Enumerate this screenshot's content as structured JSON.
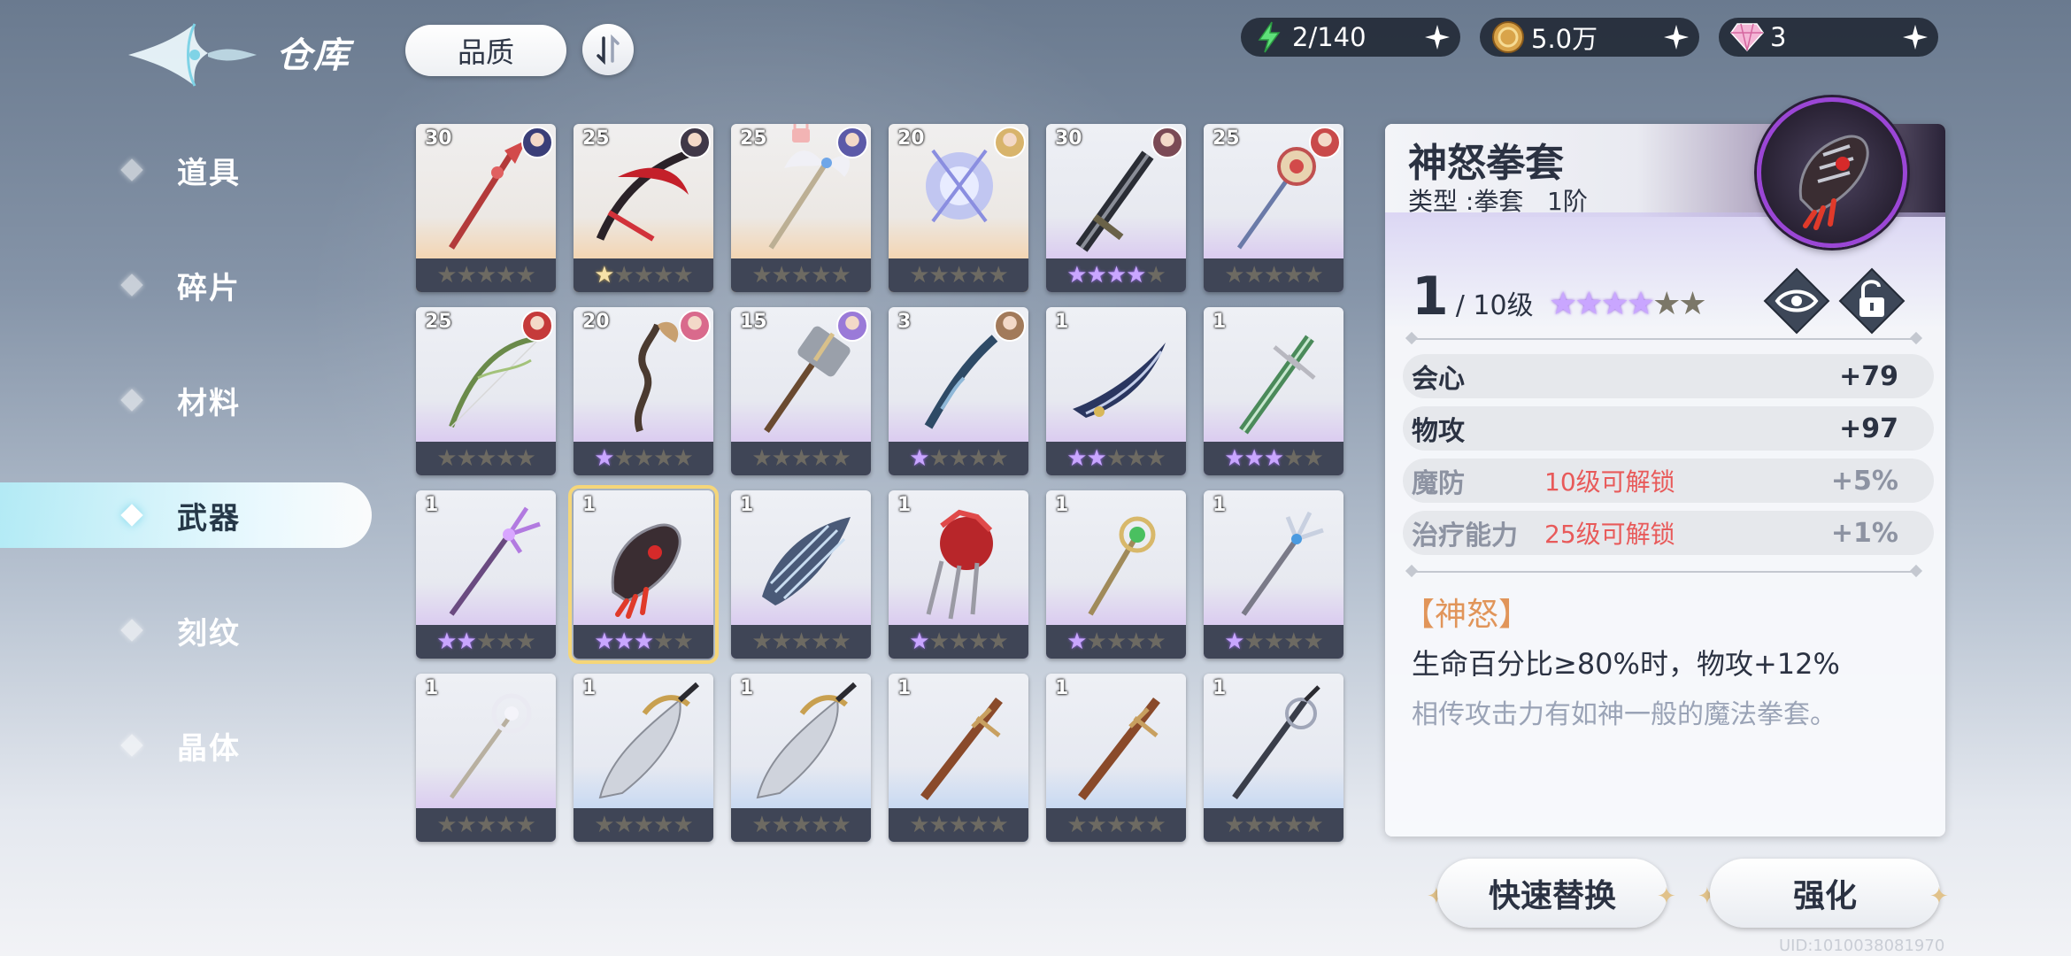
{
  "header": {
    "title": "仓库",
    "quality_label": "品质",
    "resources": [
      {
        "icon": "energy-icon",
        "value": "2/140"
      },
      {
        "icon": "coin-icon",
        "value": "5.0万"
      },
      {
        "icon": "diamond-icon",
        "value": "3"
      }
    ]
  },
  "sidebar": {
    "items": [
      {
        "label": "道具",
        "active": false
      },
      {
        "label": "碎片",
        "active": false
      },
      {
        "label": "材料",
        "active": false
      },
      {
        "label": "武器",
        "active": true
      },
      {
        "label": "刻纹",
        "active": false
      },
      {
        "label": "晶体",
        "active": false
      }
    ]
  },
  "inventory": {
    "items": [
      {
        "level": "30",
        "stars": 0,
        "rarity": "orange",
        "weapon": "red-lance",
        "avatar": "#3a3e78"
      },
      {
        "level": "25",
        "stars": 1,
        "star_color": "gold",
        "rarity": "orange",
        "weapon": "crimson-scythe",
        "avatar": "#403848"
      },
      {
        "level": "25",
        "stars": 0,
        "rarity": "orange",
        "weapon": "winged-staff",
        "avatar": "#5c5aa8",
        "locked": true
      },
      {
        "level": "20",
        "stars": 0,
        "rarity": "orange",
        "weapon": "crystal-orb",
        "avatar": "#d8b46c"
      },
      {
        "level": "30",
        "stars": 4,
        "rarity": "purple",
        "weapon": "dark-greatsword",
        "avatar": "#7b4a55"
      },
      {
        "level": "25",
        "stars": 0,
        "rarity": "purple",
        "weapon": "sun-scepter",
        "avatar": "#c94a4a"
      },
      {
        "level": "25",
        "stars": 0,
        "rarity": "purple",
        "weapon": "vine-bow",
        "avatar": "#c53a3a"
      },
      {
        "level": "20",
        "stars": 1,
        "rarity": "purple",
        "weapon": "serpent-staff",
        "avatar": "#d96a8c"
      },
      {
        "level": "15",
        "stars": 0,
        "rarity": "purple",
        "weapon": "battle-hammer",
        "avatar": "#9a7ad8"
      },
      {
        "level": "3",
        "stars": 1,
        "rarity": "purple",
        "weapon": "azure-rifle",
        "avatar": "#a27a5a"
      },
      {
        "level": "1",
        "stars": 2,
        "rarity": "purple",
        "weapon": "shadow-blade",
        "avatar": ""
      },
      {
        "level": "1",
        "stars": 3,
        "rarity": "purple",
        "weapon": "jade-sword",
        "avatar": ""
      },
      {
        "level": "1",
        "stars": 2,
        "rarity": "purple",
        "weapon": "violet-trident",
        "avatar": ""
      },
      {
        "level": "1",
        "stars": 3,
        "rarity": "purple",
        "weapon": "rage-gauntlet",
        "avatar": "",
        "selected": true
      },
      {
        "level": "1",
        "stars": 0,
        "rarity": "purple",
        "weapon": "frost-claw",
        "avatar": ""
      },
      {
        "level": "1",
        "stars": 1,
        "rarity": "purple",
        "weapon": "crimson-gauntlet",
        "avatar": ""
      },
      {
        "level": "1",
        "stars": 1,
        "rarity": "purple",
        "weapon": "emerald-staff",
        "avatar": ""
      },
      {
        "level": "1",
        "stars": 1,
        "rarity": "purple",
        "weapon": "silver-trident",
        "avatar": ""
      },
      {
        "level": "1",
        "stars": 0,
        "rarity": "purple",
        "weapon": "pearl-wand",
        "avatar": ""
      },
      {
        "level": "1",
        "stars": 0,
        "rarity": "blue",
        "weapon": "gold-cleaver",
        "avatar": ""
      },
      {
        "level": "1",
        "stars": 0,
        "rarity": "blue",
        "weapon": "gold-cleaver",
        "avatar": ""
      },
      {
        "level": "1",
        "stars": 0,
        "rarity": "blue",
        "weapon": "bronze-sword",
        "avatar": ""
      },
      {
        "level": "1",
        "stars": 0,
        "rarity": "blue",
        "weapon": "bronze-sword",
        "avatar": ""
      },
      {
        "level": "1",
        "stars": 0,
        "rarity": "blue",
        "weapon": "rapier",
        "avatar": ""
      }
    ]
  },
  "detail": {
    "name": "神怒拳套",
    "type_line": "类型 :拳套   1阶",
    "level": "1",
    "max_level": "/ 10级",
    "stars": 4,
    "stats": [
      {
        "name": "会心",
        "value": "+79",
        "locked": false,
        "lock_msg": ""
      },
      {
        "name": "物攻",
        "value": "+97",
        "locked": false,
        "lock_msg": ""
      },
      {
        "name": "魔防",
        "value": "+5%",
        "locked": true,
        "lock_msg": "10级可解锁"
      },
      {
        "name": "治疗能力",
        "value": "+1%",
        "locked": true,
        "lock_msg": "25级可解锁"
      }
    ],
    "skill_name": "【神怒】",
    "skill_desc": "生命百分比≥80%时，物攻+12%",
    "flavor": "相传攻击力有如神一般的魔法拳套。"
  },
  "actions": {
    "quick_replace": "快速替换",
    "enhance": "强化"
  },
  "uid_text": "UID:1010038081970",
  "colors": {
    "accent": "#9b46d6",
    "lock_text": "#e85a5a",
    "skill_title": "#e1955a"
  }
}
